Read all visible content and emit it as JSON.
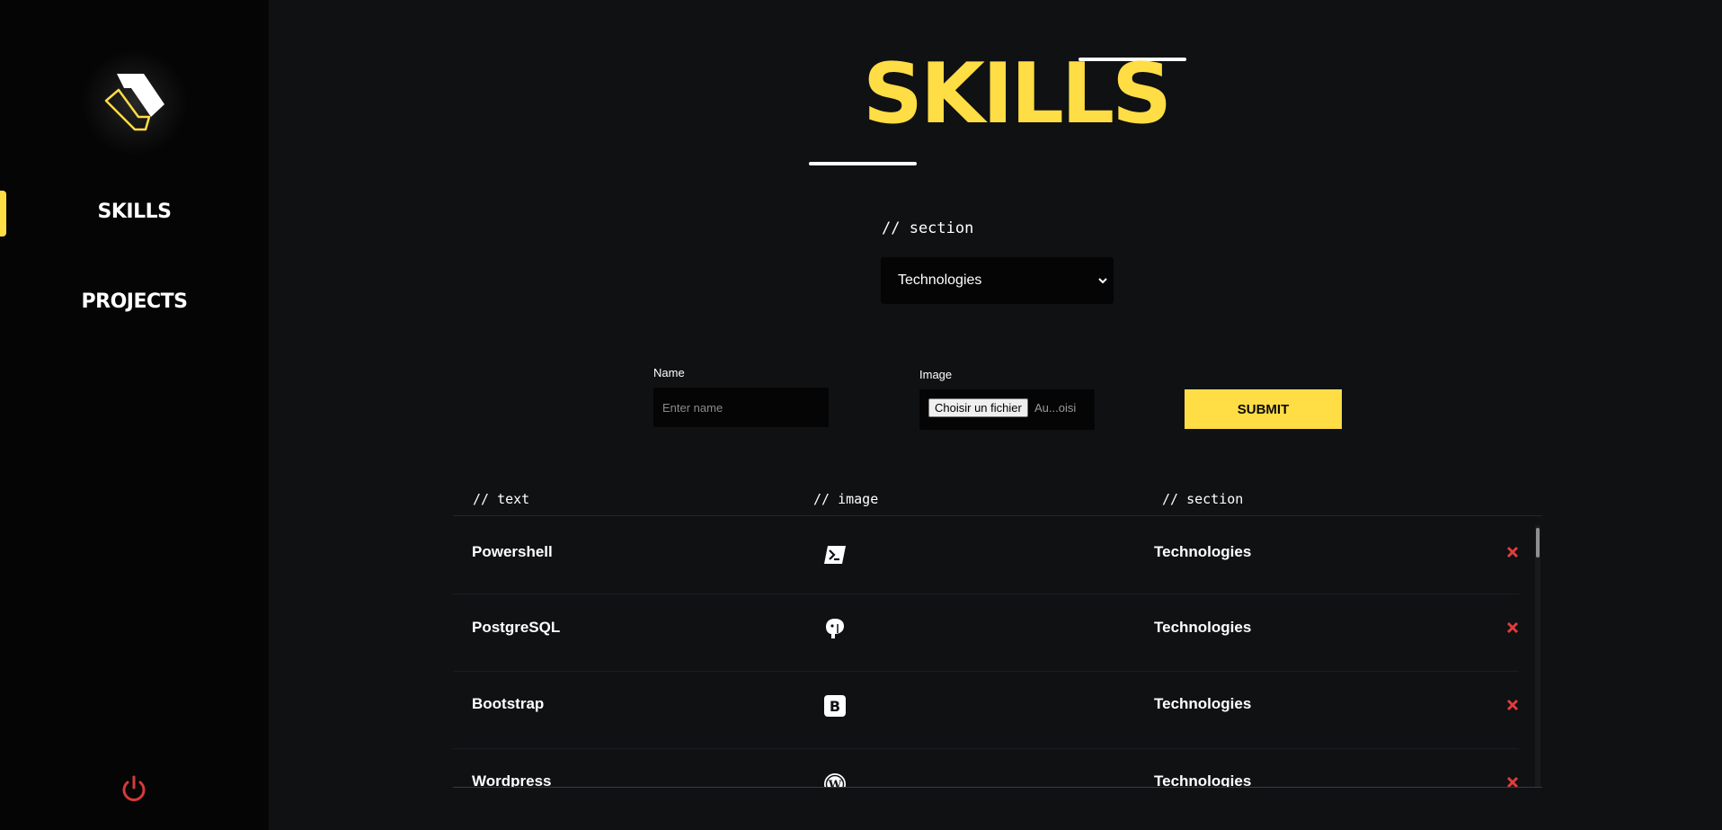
{
  "sidebar": {
    "logo_icon": "s-logo-icon",
    "items": [
      {
        "label": "SKILLS",
        "active": true
      },
      {
        "label": "PROJECTS",
        "active": false
      }
    ],
    "logout_icon": "power-icon"
  },
  "page": {
    "title": "SKILLS"
  },
  "section_filter": {
    "label": "// section",
    "selected": "Technologies"
  },
  "form": {
    "name_label": "Name",
    "name_placeholder": "Enter name",
    "image_label": "Image",
    "file_button": "Choisir un fichier",
    "file_status": "Au...oisi",
    "submit_label": "SUBMIT"
  },
  "table": {
    "columns": [
      "// text",
      "// image",
      "// section"
    ],
    "rows": [
      {
        "text": "Powershell",
        "icon": "powershell-icon",
        "section": "Technologies"
      },
      {
        "text": "PostgreSQL",
        "icon": "postgresql-icon",
        "section": "Technologies"
      },
      {
        "text": "Bootstrap",
        "icon": "bootstrap-icon",
        "section": "Technologies"
      },
      {
        "text": "Wordpress",
        "icon": "wordpress-icon",
        "section": "Technologies"
      }
    ],
    "delete_icon": "close-icon"
  },
  "colors": {
    "accent": "#ffdd44",
    "background": "#0f1113",
    "sidebar": "#050505",
    "danger": "#e03c3c"
  }
}
